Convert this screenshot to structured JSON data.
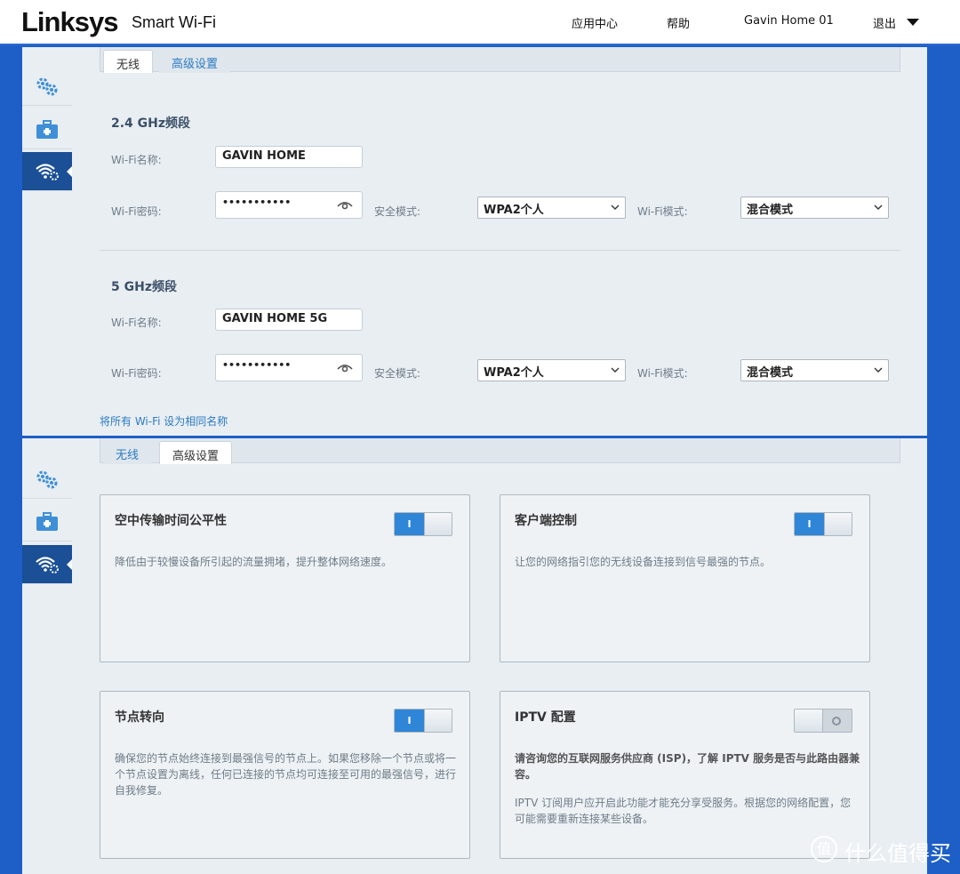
{
  "header": {
    "brand": "Linksys",
    "product": "Smart Wi-Fi",
    "nav": [
      "应用中心",
      "帮助",
      "Gavin Home 01",
      "退出"
    ]
  },
  "tabs": {
    "wireless": "无线",
    "advanced": "高级设置"
  },
  "sidebar": {
    "items": [
      "gears-icon",
      "toolbox-icon",
      "wifi-settings-icon"
    ],
    "active_index": 2
  },
  "wireless": {
    "band24": {
      "title": "2.4 GHz频段",
      "name_label": "Wi-Fi名称:",
      "name_value": "GAVIN HOME",
      "password_label": "Wi-Fi密码:",
      "password_value": "•••••••••••",
      "security_label": "安全模式:",
      "security_value": "WPA2个人",
      "mode_label": "Wi-Fi模式:",
      "mode_value": "混合模式"
    },
    "band5": {
      "title": "5 GHz频段",
      "name_label": "Wi-Fi名称:",
      "name_value": "GAVIN HOME 5G",
      "password_label": "Wi-Fi密码:",
      "password_value": "•••••••••••",
      "security_label": "安全模式:",
      "security_value": "WPA2个人",
      "mode_label": "Wi-Fi模式:",
      "mode_value": "混合模式"
    },
    "same_name_link": "将所有 Wi-Fi 设为相同名称"
  },
  "advanced": {
    "cards": [
      {
        "title": "空中传输时间公平性",
        "desc": "降低由于较慢设备所引起的流量拥堵，提升整体网络速度。",
        "toggle_on": true,
        "toggle_label": "I"
      },
      {
        "title": "客户端控制",
        "desc": "让您的网络指引您的无线设备连接到信号最强的节点。",
        "toggle_on": true,
        "toggle_label": "I"
      },
      {
        "title": "节点转向",
        "desc": "确保您的节点始终连接到最强信号的节点上。如果您移除一个节点或将一个节点设置为离线，任何已连接的节点均可连接至可用的最强信号，进行自我修复。",
        "toggle_on": true,
        "toggle_label": "I"
      },
      {
        "title": "IPTV 配置",
        "desc": "请咨询您的互联网服务供应商 (ISP)，了解 IPTV 服务是否与此路由器兼容。",
        "desc2": "IPTV 订阅用户应开启此功能才能充分享受服务。根据您的网络配置，您可能需要重新连接某些设备。",
        "toggle_on": false
      }
    ]
  },
  "watermark": {
    "badge": "值",
    "text": "什么值得买"
  },
  "colors": {
    "accent": "#2f86d6",
    "background": "#1d5fc6",
    "panel": "#e9eef3",
    "sidebar_active": "#1b4f96"
  }
}
